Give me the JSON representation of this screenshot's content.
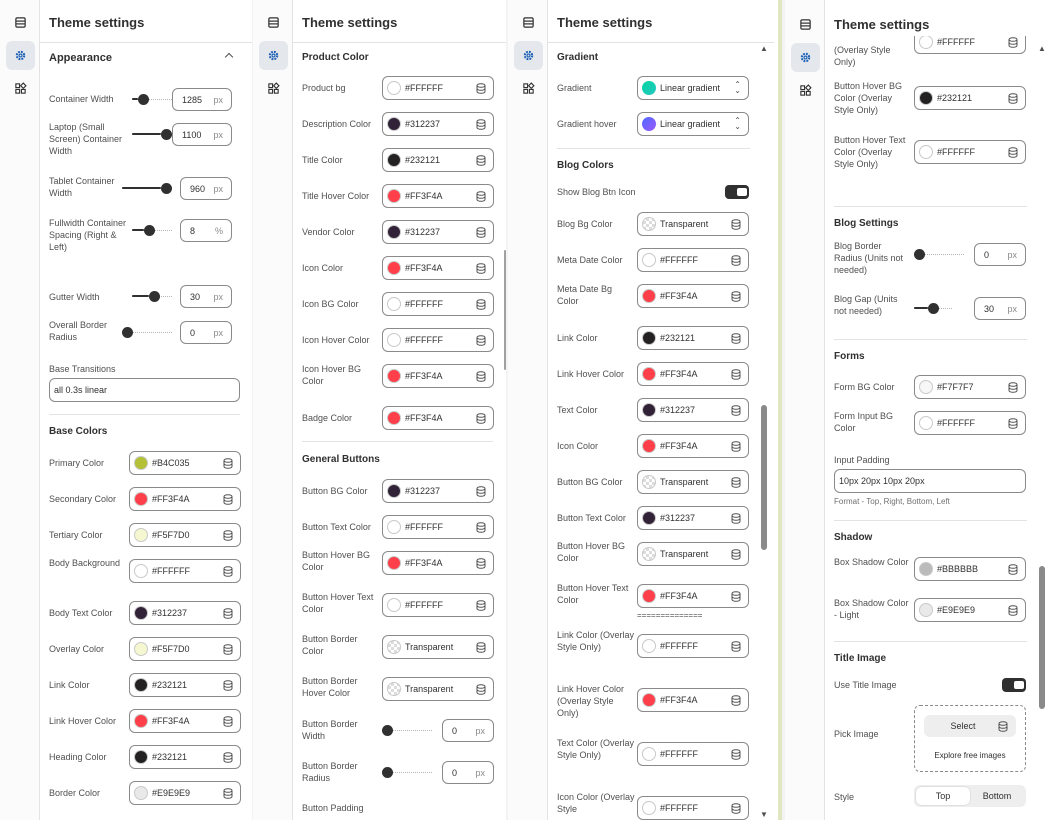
{
  "panel_title": "Theme settings",
  "icons": {
    "rail": [
      "layout-icon",
      "gear-icon",
      "blocks-icon"
    ],
    "field_action": "database-icon"
  },
  "colors": {
    "dark": "#303030",
    "active_rail": "#e4e7ec",
    "gradient_start": "#00d4a0",
    "gradient_end": "#4f6bff"
  },
  "panel1": {
    "section_appearance": "Appearance",
    "sliders": [
      {
        "label": "Container Width",
        "value": "1285",
        "unit": "px",
        "level": 0.2
      },
      {
        "label": "Laptop (Small Screen) Container Width",
        "value": "1100",
        "unit": "px",
        "level": 1.0
      },
      {
        "label": "Tablet Container Width",
        "value": "960",
        "unit": "px",
        "level": 1.0
      },
      {
        "label": "Fullwidth Container Spacing (Right & Left)",
        "value": "8",
        "unit": "%",
        "level": 0.4
      },
      {
        "label": "Gutter Width",
        "value": "30",
        "unit": "px",
        "level": 0.6
      },
      {
        "label": "Overall Border Radius",
        "value": "0",
        "unit": "px",
        "level": 0.0
      }
    ],
    "base_transitions_label": "Base Transitions",
    "base_transitions_value": "all 0.3s linear",
    "section_base_colors": "Base Colors",
    "colors": [
      {
        "label": "Primary Color",
        "value": "#B4C035",
        "swatch": "#B4C035"
      },
      {
        "label": "Secondary Color",
        "value": "#FF3F4A",
        "swatch": "#FF3F4A"
      },
      {
        "label": "Tertiary Color",
        "value": "#F5F7D0",
        "swatch": "#F5F7D0"
      },
      {
        "label": "Body Background",
        "value": "#FFFFFF",
        "swatch": "#FFFFFF"
      },
      {
        "label": "Body Text Color",
        "value": "#312237",
        "swatch": "#312237"
      },
      {
        "label": "Overlay Color",
        "value": "#F5F7D0",
        "swatch": "#F5F7D0"
      },
      {
        "label": "Link Color",
        "value": "#232121",
        "swatch": "#232121"
      },
      {
        "label": "Link Hover Color",
        "value": "#FF3F4A",
        "swatch": "#FF3F4A"
      },
      {
        "label": "Heading Color",
        "value": "#232121",
        "swatch": "#232121"
      },
      {
        "label": "Border Color",
        "value": "#E9E9E9",
        "swatch": "#E9E9E9"
      }
    ]
  },
  "panel2": {
    "section_product": "Product Color",
    "product_colors": [
      {
        "label": "Product bg",
        "value": "#FFFFFF",
        "swatch": "#FFFFFF"
      },
      {
        "label": "Description Color",
        "value": "#312237",
        "swatch": "#312237"
      },
      {
        "label": "Title Color",
        "value": "#232121",
        "swatch": "#232121"
      },
      {
        "label": "Title Hover Color",
        "value": "#FF3F4A",
        "swatch": "#FF3F4A"
      },
      {
        "label": "Vendor Color",
        "value": "#312237",
        "swatch": "#312237"
      },
      {
        "label": "Icon Color",
        "value": "#FF3F4A",
        "swatch": "#FF3F4A"
      },
      {
        "label": "Icon BG Color",
        "value": "#FFFFFF",
        "swatch": "#FFFFFF"
      },
      {
        "label": "Icon Hover Color",
        "value": "#FFFFFF",
        "swatch": "#FFFFFF"
      },
      {
        "label": "Icon Hover BG Color",
        "value": "#FF3F4A",
        "swatch": "#FF3F4A"
      },
      {
        "label": "Badge Color",
        "value": "#FF3F4A",
        "swatch": "#FF3F4A"
      }
    ],
    "section_buttons": "General Buttons",
    "button_colors": [
      {
        "label": "Button BG Color",
        "value": "#312237",
        "swatch": "#312237"
      },
      {
        "label": "Button Text Color",
        "value": "#FFFFFF",
        "swatch": "#FFFFFF"
      },
      {
        "label": "Button Hover BG Color",
        "value": "#FF3F4A",
        "swatch": "#FF3F4A"
      },
      {
        "label": "Button Hover Text Color",
        "value": "#FFFFFF",
        "swatch": "#FFFFFF"
      },
      {
        "label": "Button Border Color",
        "value": "Transparent",
        "swatch": "transparent"
      },
      {
        "label": "Button Border Hover Color",
        "value": "Transparent",
        "swatch": "transparent"
      }
    ],
    "button_sliders": [
      {
        "label": "Button Border Width",
        "value": "0",
        "unit": "px",
        "level": 0.0
      },
      {
        "label": "Button Border Radius",
        "value": "0",
        "unit": "px",
        "level": 0.0
      }
    ],
    "button_padding_label": "Button Padding"
  },
  "panel3": {
    "section_gradient": "Gradient",
    "gradients": [
      {
        "label": "Gradient",
        "value": "Linear gradient"
      },
      {
        "label": "Gradient hover",
        "value": "Linear gradient"
      }
    ],
    "section_blog": "Blog Colors",
    "show_btn_label": "Show Blog Btn Icon",
    "blog_colors": [
      {
        "label": "Blog Bg Color",
        "value": "Transparent",
        "swatch": "transparent"
      },
      {
        "label": "Meta Date Color",
        "value": "#FFFFFF",
        "swatch": "#FFFFFF"
      },
      {
        "label": "Meta Date Bg Color",
        "value": "#FF3F4A",
        "swatch": "#FF3F4A"
      },
      {
        "label": "Link Color",
        "value": "#232121",
        "swatch": "#232121"
      },
      {
        "label": "Link Hover Color",
        "value": "#FF3F4A",
        "swatch": "#FF3F4A"
      },
      {
        "label": "Text Color",
        "value": "#312237",
        "swatch": "#312237"
      },
      {
        "label": "Icon Color",
        "value": "#FF3F4A",
        "swatch": "#FF3F4A"
      },
      {
        "label": "Button BG Color",
        "value": "Transparent",
        "swatch": "transparent"
      },
      {
        "label": "Button Text Color",
        "value": "#312237",
        "swatch": "#312237"
      },
      {
        "label": "Button Hover BG Color",
        "value": "Transparent",
        "swatch": "transparent"
      },
      {
        "label": "Button Hover Text Color",
        "value": "#FF3F4A",
        "swatch": "#FF3F4A"
      },
      {
        "label": "Link Color (Overlay Style Only)",
        "value": "#FFFFFF",
        "swatch": "#FFFFFF"
      },
      {
        "label": "Link Hover Color (Overlay Style Only)",
        "value": "#FF3F4A",
        "swatch": "#FF3F4A"
      },
      {
        "label": "Text Color (Overlay Style Only)",
        "value": "#FFFFFF",
        "swatch": "#FFFFFF"
      },
      {
        "label": "Icon Color (Overlay Style",
        "value": "#FFFFFF",
        "swatch": "#FFFFFF"
      }
    ],
    "separator": "=============="
  },
  "panel4": {
    "top_colors": [
      {
        "label": "(Overlay Style Only)",
        "value": "#FFFFFF",
        "swatch": "#FFFFFF"
      },
      {
        "label": "Button Hover BG Color (Overlay Style Only)",
        "value": "#232121",
        "swatch": "#232121"
      },
      {
        "label": "Button Hover Text Color (Overlay Style Only)",
        "value": "#FFFFFF",
        "swatch": "#FFFFFF"
      }
    ],
    "section_blog_settings": "Blog Settings",
    "blog_sliders": [
      {
        "label": "Blog Border Radius (Units not needed)",
        "value": "0",
        "unit": "px",
        "level": 0.0
      },
      {
        "label": "Blog Gap (Units not needed)",
        "value": "30",
        "unit": "px",
        "level": 0.5
      }
    ],
    "section_forms": "Forms",
    "form_colors": [
      {
        "label": "Form BG Color",
        "value": "#F7F7F7",
        "swatch": "#F7F7F7"
      },
      {
        "label": "Form Input BG Color",
        "value": "#FFFFFF",
        "swatch": "#FFFFFF"
      }
    ],
    "input_padding_label": "Input Padding",
    "input_padding_value": "10px 20px 10px 20px",
    "input_padding_help": "Format - Top, Right, Bottom, Left",
    "section_shadow": "Shadow",
    "shadow_colors": [
      {
        "label": "Box Shadow Color",
        "value": "#BBBBBB",
        "swatch": "#BBBBBB"
      },
      {
        "label": "Box Shadow Color - Light",
        "value": "#E9E9E9",
        "swatch": "#E9E9E9"
      }
    ],
    "section_title_image": "Title Image",
    "use_title_image_label": "Use Title Image",
    "pick_image_label": "Pick Image",
    "select_label": "Select",
    "explore_label": "Explore free images",
    "style_label": "Style",
    "style_options": [
      "Top",
      "Bottom"
    ]
  }
}
